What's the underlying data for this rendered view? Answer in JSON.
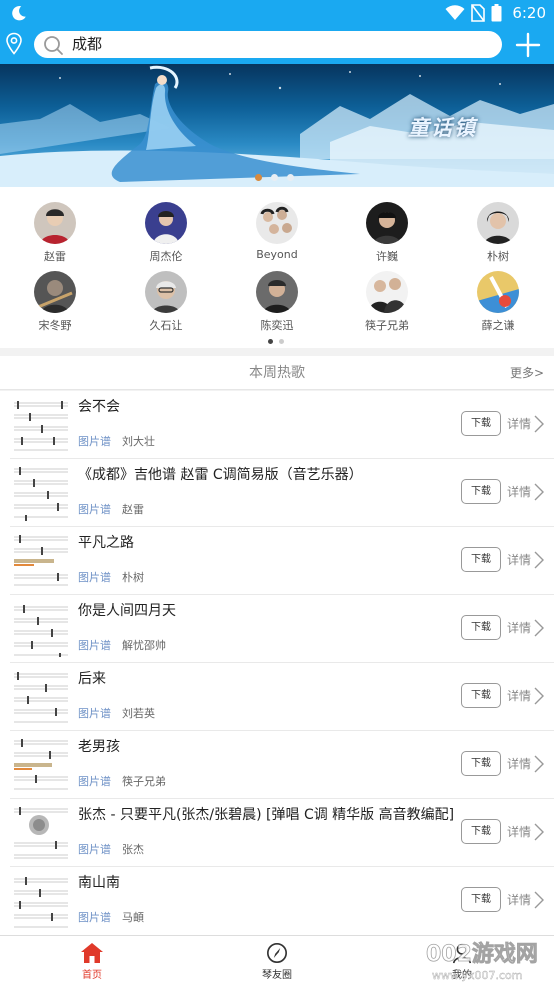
{
  "status_bar": {
    "time": "6:20"
  },
  "search": {
    "value": "成都"
  },
  "banner": {
    "title": "童话镇",
    "dots": 3,
    "active_dot": 0
  },
  "artists": [
    {
      "name": "赵雷"
    },
    {
      "name": "周杰伦"
    },
    {
      "name": "Beyond"
    },
    {
      "name": "许巍"
    },
    {
      "name": "朴树"
    },
    {
      "name": "宋冬野"
    },
    {
      "name": "久石让"
    },
    {
      "name": "陈奕迅"
    },
    {
      "name": "筷子兄弟"
    },
    {
      "name": "薛之谦"
    }
  ],
  "artist_pager": {
    "pages": 2,
    "active": 0
  },
  "section": {
    "title": "本周热歌",
    "more": "更多>"
  },
  "songs": [
    {
      "title": "会不会",
      "tag": "图片谱",
      "artist": "刘大壮",
      "download": "下载",
      "detail": "详情"
    },
    {
      "title": "《成都》吉他谱 赵雷 C调简易版（音艺乐器）",
      "tag": "图片谱",
      "artist": "赵雷",
      "download": "下载",
      "detail": "详情"
    },
    {
      "title": "平凡之路",
      "tag": "图片谱",
      "artist": "朴树",
      "download": "下载",
      "detail": "详情"
    },
    {
      "title": "你是人间四月天",
      "tag": "图片谱",
      "artist": "解忧邵帅",
      "download": "下载",
      "detail": "详情"
    },
    {
      "title": "后来",
      "tag": "图片谱",
      "artist": "刘若英",
      "download": "下载",
      "detail": "详情"
    },
    {
      "title": "老男孩",
      "tag": "图片谱",
      "artist": "筷子兄弟",
      "download": "下载",
      "detail": "详情"
    },
    {
      "title": "张杰 - 只要平凡(张杰/张碧晨) [弹唱 C调 精华版 高音教编配]",
      "tag": "图片谱",
      "artist": "张杰",
      "download": "下载",
      "detail": "详情"
    },
    {
      "title": "南山南",
      "tag": "图片谱",
      "artist": "马頔",
      "download": "下载",
      "detail": "详情"
    }
  ],
  "nav": [
    {
      "label": "首页",
      "active": true
    },
    {
      "label": "琴友圈",
      "active": false
    },
    {
      "label": "我的",
      "active": false
    }
  ],
  "watermark": {
    "line1": "002游戏网",
    "line2": "www.yx007.com"
  },
  "colors": {
    "header": "#1aa9f1",
    "nav_active": "#e0392a",
    "tag": "#6e91c6"
  }
}
